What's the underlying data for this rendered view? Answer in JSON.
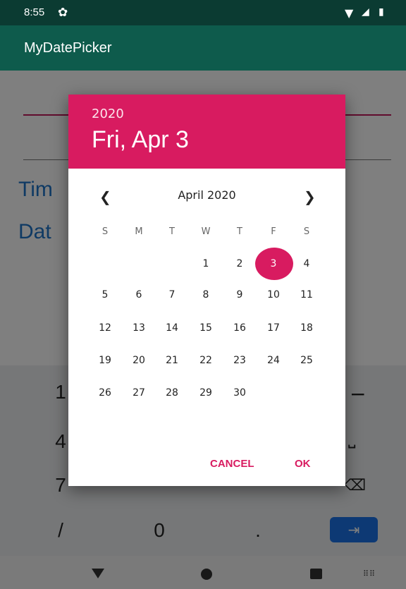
{
  "status_bar": {
    "time": "8:55",
    "icons": [
      "gear-icon",
      "wifi-icon",
      "signal-icon",
      "battery-icon"
    ]
  },
  "app": {
    "title": "MyDatePicker"
  },
  "background": {
    "labels": [
      "Tim",
      "Dat"
    ]
  },
  "keyboard": {
    "keys": [
      "1",
      "4",
      "7",
      "/",
      "0",
      "."
    ]
  },
  "dialog": {
    "year": "2020",
    "selected_date_label": "Fri, Apr 3",
    "month_label": "April 2020",
    "weekdays": [
      "S",
      "M",
      "T",
      "W",
      "T",
      "F",
      "S"
    ],
    "weeks": [
      [
        "",
        "",
        "",
        "1",
        "2",
        "3",
        "4"
      ],
      [
        "5",
        "6",
        "7",
        "8",
        "9",
        "10",
        "11"
      ],
      [
        "12",
        "13",
        "14",
        "15",
        "16",
        "17",
        "18"
      ],
      [
        "19",
        "20",
        "21",
        "22",
        "23",
        "24",
        "25"
      ],
      [
        "26",
        "27",
        "28",
        "29",
        "30",
        "",
        ""
      ]
    ],
    "selected_day": "3",
    "cancel_label": "CANCEL",
    "ok_label": "OK"
  },
  "colors": {
    "accent": "#d81b60",
    "appbar": "#0e5b4c",
    "statusbar": "#0b3b32",
    "label_blue": "#1e74c8"
  }
}
